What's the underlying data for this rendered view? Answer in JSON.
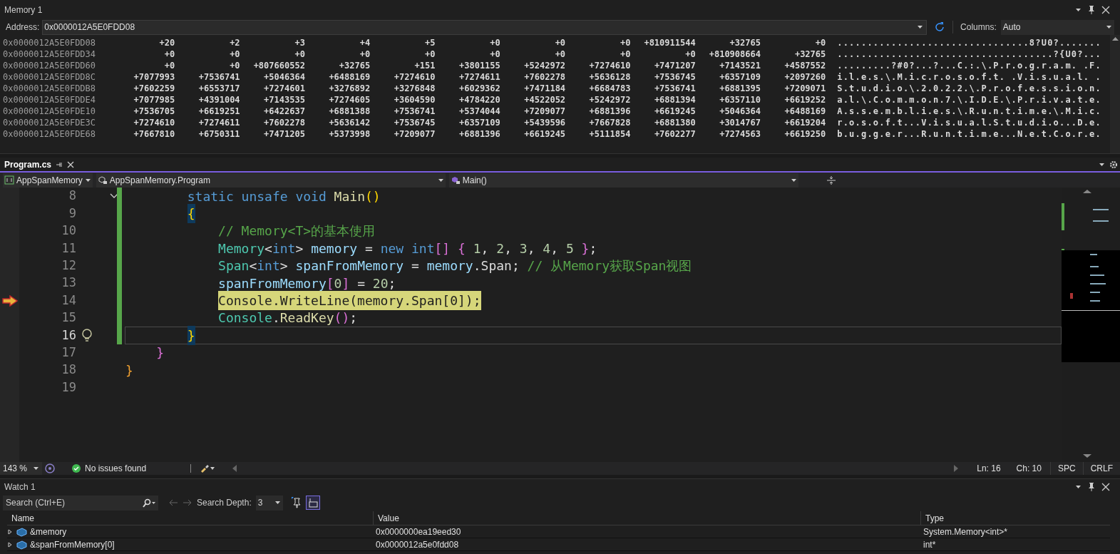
{
  "memory_window": {
    "title": "Memory 1",
    "address_label": "Address:",
    "address": "0x0000012A5E0FDD08",
    "columns_label": "Columns:",
    "columns": "Auto",
    "rows": [
      {
        "address": "0x0000012A5E0FDD08",
        "values": [
          "+20",
          "+2",
          "+3",
          "+4",
          "+5",
          "+0",
          "+0",
          "+0",
          "+810911544",
          "+32765",
          "+0"
        ],
        "text": "................................8?U0?......."
      },
      {
        "address": "0x0000012A5E0FDD34",
        "values": [
          "+0",
          "+0",
          "+0",
          "+0",
          "+0",
          "+0",
          "+0",
          "+0",
          "+0",
          "+810908664",
          "+32765"
        ],
        "text": "....................................?{U0?..."
      },
      {
        "address": "0x0000012A5E0FDD60",
        "values": [
          "+0",
          "+0",
          "+807660552",
          "+32765",
          "+151",
          "+3801155",
          "+5242972",
          "+7274610",
          "+7471207",
          "+7143521",
          "+4587552"
        ],
        "text": ".........?#0?...?...C.:.\\.P.r.o.g.r.a.m. .F."
      },
      {
        "address": "0x0000012A5E0FDD8C",
        "values": [
          "+7077993",
          "+7536741",
          "+5046364",
          "+6488169",
          "+7274610",
          "+7274611",
          "+7602278",
          "+5636128",
          "+7536745",
          "+6357109",
          "+2097260"
        ],
        "text": "i.l.e.s.\\.M.i.c.r.o.s.o.f.t. .V.i.s.u.a.l. ."
      },
      {
        "address": "0x0000012A5E0FDDB8",
        "values": [
          "+7602259",
          "+6553717",
          "+7274601",
          "+3276892",
          "+3276848",
          "+6029362",
          "+7471184",
          "+6684783",
          "+7536741",
          "+6881395",
          "+7209071"
        ],
        "text": "S.t.u.d.i.o.\\.2.0.2.2.\\.P.r.o.f.e.s.s.i.o.n."
      },
      {
        "address": "0x0000012A5E0FDDE4",
        "values": [
          "+7077985",
          "+4391004",
          "+7143535",
          "+7274605",
          "+3604590",
          "+4784220",
          "+4522052",
          "+5242972",
          "+6881394",
          "+6357110",
          "+6619252"
        ],
        "text": "a.l.\\.C.o.m.m.o.n.7.\\.I.D.E.\\.P.r.i.v.a.t.e."
      },
      {
        "address": "0x0000012A5E0FDE10",
        "values": [
          "+7536705",
          "+6619251",
          "+6422637",
          "+6881388",
          "+7536741",
          "+5374044",
          "+7209077",
          "+6881396",
          "+6619245",
          "+5046364",
          "+6488169"
        ],
        "text": "A.s.s.e.m.b.l.i.e.s.\\.R.u.n.t.i.m.e.\\.M.i.c."
      },
      {
        "address": "0x0000012A5E0FDE3C",
        "values": [
          "+7274610",
          "+7274611",
          "+7602278",
          "+5636142",
          "+7536745",
          "+6357109",
          "+5439596",
          "+7667828",
          "+6881380",
          "+3014767",
          "+6619204"
        ],
        "text": "r.o.s.o.f.t...V.i.s.u.a.l.S.t.u.d.i.o...D.e."
      },
      {
        "address": "0x0000012A5E0FDE68",
        "values": [
          "+7667810",
          "+6750311",
          "+7471205",
          "+5373998",
          "+7209077",
          "+6881396",
          "+6619245",
          "+5111854",
          "+7602277",
          "+7274563",
          "+6619250"
        ],
        "text": "b.u.g.g.e.r...R.u.n.t.i.m.e...N.e.t.C.o.r.e."
      }
    ]
  },
  "editor": {
    "tab": {
      "label": "Program.cs",
      "selected": true
    },
    "nav": {
      "project": "AppSpanMemory",
      "type": "AppSpanMemory.Program",
      "member": "Main()"
    },
    "lines": [
      {
        "number": "8",
        "tokens": [
          {
            "kind": "keyword",
            "text": "        static unsafe void"
          },
          {
            "kind": "method",
            "text": " Main"
          },
          {
            "kind": "brace_yellow",
            "text": "()"
          }
        ]
      },
      {
        "number": "9",
        "tokens": [
          {
            "kind": "brace_match",
            "text": "        {"
          }
        ]
      },
      {
        "number": "10",
        "tokens": [
          {
            "kind": "comment",
            "text": "            // Memory<T>的基本使用"
          }
        ]
      },
      {
        "number": "11",
        "tokens": [
          {
            "kind": "type",
            "text": "            Memory"
          },
          {
            "kind": "plain",
            "text": "<"
          },
          {
            "kind": "keyword",
            "text": "int"
          },
          {
            "kind": "plain",
            "text": "> "
          },
          {
            "kind": "variable",
            "text": "memory"
          },
          {
            "kind": "plain",
            "text": " = "
          },
          {
            "kind": "keyword",
            "text": "new int"
          },
          {
            "kind": "brace_purple",
            "text": "[]"
          },
          {
            "kind": "brace_purple",
            "text": " {"
          },
          {
            "kind": "number",
            "text": " 1"
          },
          {
            "kind": "plain",
            "text": ", "
          },
          {
            "kind": "number",
            "text": "2"
          },
          {
            "kind": "plain",
            "text": ", "
          },
          {
            "kind": "number",
            "text": "3"
          },
          {
            "kind": "plain",
            "text": ", "
          },
          {
            "kind": "number",
            "text": "4"
          },
          {
            "kind": "plain",
            "text": ", "
          },
          {
            "kind": "number",
            "text": "5"
          },
          {
            "kind": "brace_purple",
            "text": " }"
          },
          {
            "kind": "plain",
            "text": ";"
          }
        ]
      },
      {
        "number": "12",
        "tokens": [
          {
            "kind": "type",
            "text": "            Span"
          },
          {
            "kind": "plain",
            "text": "<"
          },
          {
            "kind": "keyword",
            "text": "int"
          },
          {
            "kind": "plain",
            "text": "> "
          },
          {
            "kind": "variable",
            "text": "spanFromMemory"
          },
          {
            "kind": "plain",
            "text": " = "
          },
          {
            "kind": "variable",
            "text": "memory"
          },
          {
            "kind": "plain",
            "text": ".Span; "
          },
          {
            "kind": "comment",
            "text": "// 从Memory获取Span视图"
          }
        ]
      },
      {
        "number": "13",
        "tokens": [
          {
            "kind": "variable",
            "text": "            spanFromMemory"
          },
          {
            "kind": "brace_purple",
            "text": "["
          },
          {
            "kind": "number",
            "text": "0"
          },
          {
            "kind": "brace_purple",
            "text": "]"
          },
          {
            "kind": "plain",
            "text": " = "
          },
          {
            "kind": "number",
            "text": "20"
          },
          {
            "kind": "plain",
            "text": ";"
          }
        ]
      },
      {
        "number": "14",
        "current_statement": true,
        "tokens": [
          {
            "kind": "plain",
            "text": "            Console.WriteLine(memory.Span[0]);"
          }
        ]
      },
      {
        "number": "15",
        "tokens": [
          {
            "kind": "type",
            "text": "            Console"
          },
          {
            "kind": "plain",
            "text": "."
          },
          {
            "kind": "method",
            "text": "ReadKey"
          },
          {
            "kind": "brace_purple",
            "text": "()"
          },
          {
            "kind": "plain",
            "text": ";"
          }
        ]
      },
      {
        "number": "16",
        "caret_line": true,
        "tokens": [
          {
            "kind": "brace_match",
            "text": "        }"
          }
        ]
      },
      {
        "number": "17",
        "tokens": [
          {
            "kind": "brace_purple",
            "text": "    }"
          }
        ]
      },
      {
        "number": "18",
        "tokens": [
          {
            "kind": "brace_orange",
            "text": "}"
          }
        ]
      },
      {
        "number": "19"
      }
    ]
  },
  "status_bar": {
    "zoom": "143 %",
    "issues": "No issues found",
    "line": "Ln: 16",
    "column": "Ch: 10",
    "whitespace": "SPC",
    "line_ending": "CRLF"
  },
  "watch_window": {
    "title": "Watch 1",
    "search_placeholder": "Search (Ctrl+E)",
    "depth_label": "Search Depth:",
    "depth": "3",
    "columns": [
      "Name",
      "Value",
      "Type"
    ],
    "rows": [
      {
        "name": "&memory",
        "value": "0x0000000ea19eed30",
        "type": "System.Memory<int>*"
      },
      {
        "name": "&spanFromMemory[0]",
        "value": "0x0000012a5e0fdd08",
        "type": "int*"
      }
    ]
  }
}
